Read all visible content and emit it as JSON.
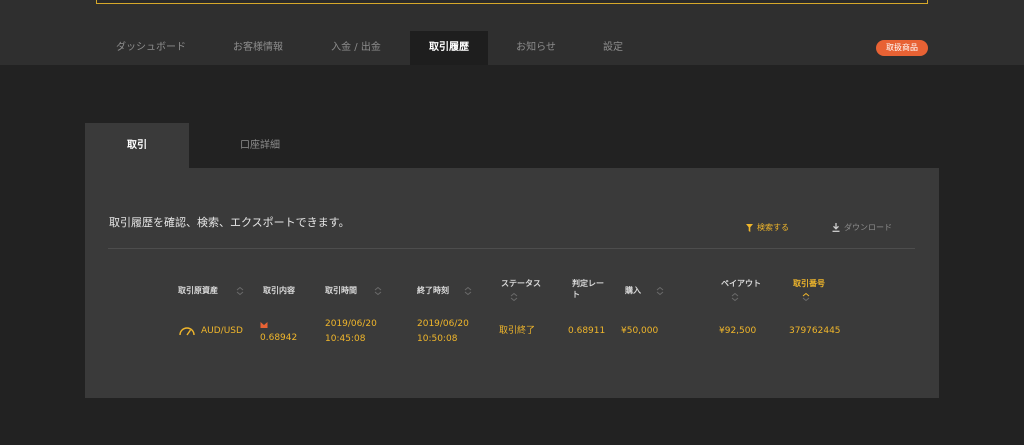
{
  "nav": {
    "tabs": [
      {
        "label": "ダッシュボード"
      },
      {
        "label": "お客様情報"
      },
      {
        "label": "入金 / 出金"
      },
      {
        "label": "取引履歴"
      },
      {
        "label": "お知らせ"
      },
      {
        "label": "設定"
      }
    ],
    "active": "取引履歴",
    "products_button": "取扱商品"
  },
  "subtabs": {
    "trade": "取引",
    "account": "口座詳細"
  },
  "panel": {
    "intro": "取引履歴を確認、検索、エクスポートできます。",
    "search_label": "検索する",
    "download_label": "ダウンロード"
  },
  "table": {
    "headers": {
      "asset": "取引原資産",
      "content": "取引内容",
      "time": "取引時間",
      "end_time": "終了時刻",
      "status": "ステータス",
      "rate_1": "判定レー",
      "rate_2": "ト",
      "purchase": "購入",
      "payout": "ペイアウト",
      "number": "取引番号"
    },
    "rows": [
      {
        "asset": "AUD/USD",
        "content": "0.68942",
        "time_date": "2019/06/20",
        "time_clock": "10:45:08",
        "end_date": "2019/06/20",
        "end_clock": "10:50:08",
        "status": "取引終了",
        "rate": "0.68911",
        "purchase": "¥50,000",
        "payout": "¥92,500",
        "number": "379762445"
      }
    ]
  },
  "colors": {
    "accent": "#f0b62b",
    "products_button": "#e86234",
    "direction_marker": "#e86234"
  }
}
